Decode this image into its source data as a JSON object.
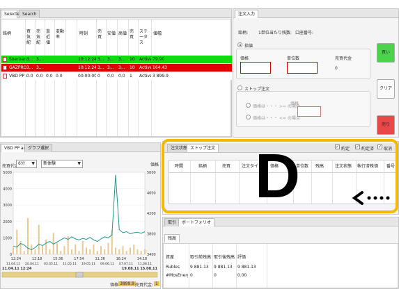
{
  "top_tabs": [
    "Selected tab",
    "Search"
  ],
  "instruments_grid": {
    "headers": [
      "銘柄",
      "買気配",
      "売気配",
      "直近値",
      "変動率",
      "時刻",
      "売買",
      "安値",
      "高値",
      "売買",
      "ステータス",
      "値幅"
    ],
    "rows": [
      {
        "icon": "red-doc-icon",
        "name": "Sberbank",
        "buy": "3...",
        "sell": "3...",
        "last": "",
        "chg": "",
        "time": "10:12:24",
        "v1": "3...",
        "low": "3...",
        "high": "3...",
        "v2": "10",
        "status": "Active",
        "range": "79.90",
        "color": "#0fdc0f"
      },
      {
        "icon": "red-doc-icon",
        "name": "GAZPROM ao",
        "buy": "3...",
        "sell": "3...",
        "last": "",
        "chg": "",
        "time": "10:12:24",
        "v1": "3...",
        "low": "3...",
        "high": "3...",
        "v2": "10",
        "status": "Active",
        "range": "164.43",
        "color": "#e00000"
      },
      {
        "icon": "red-doc-icon",
        "name": "VBD PP ao",
        "buy": "0.0",
        "sell": "0.0",
        "last": "0.0",
        "chg": "0.0",
        "time": "00:00:00",
        "v1": "0",
        "low": "0.0",
        "high": "0.0",
        "v2": "1",
        "status": "Active",
        "range": "3 899.9",
        "color": "#ffffff"
      }
    ]
  },
  "order_entry": {
    "tab": "注文入力",
    "label_symbol": "銘柄:",
    "symbol_value": "1単位当たり残数:",
    "label_account": "口座番号:",
    "limit_label": "指値",
    "price_label": "価格",
    "qty_label": "単位数",
    "total_label": "売買代金",
    "total_value": "0",
    "stop_label": "ストップ注文",
    "cond_above": "価格は・・・ >= の場合",
    "cond_below": "価格は・・・ <= の場合",
    "trigger_label": "価格",
    "buy_label": "買い",
    "clear_label": "クリア",
    "sell_label": "売り",
    "buy_color": "#4cd34c",
    "sell_color": "#e84848"
  },
  "chart_panel": {
    "tabs": [
      "VBD PP ao",
      "グラフ選択"
    ],
    "interval_label": "売買代金",
    "interval_value": "6分",
    "style_value": "新体験",
    "right_label": "価格",
    "footer_price_label": "価格:",
    "footer_price": "3899.9",
    "footer_vol_label": "売買代金:",
    "footer_vol": "1"
  },
  "chart_data": {
    "type": "line",
    "x": [
      "12:24",
      "12:18",
      "15:36",
      "17:54",
      "11:36",
      "16:24",
      "14:18"
    ],
    "dates": [
      "11.04.11",
      "20.04.11",
      "03.05.11",
      "11.05.11",
      "19.05.11",
      "09.06.11",
      "07.07.11",
      "11.08.11"
    ],
    "range_start": "11.04.11 12:24",
    "range_end": "19.08.11 15.08.11",
    "left_axis": [
      5000,
      4000,
      3000,
      2000,
      1000,
      0
    ],
    "right_axis": [
      5000,
      4600,
      4200,
      3800,
      3400
    ],
    "ylim_price": [
      3400,
      5000
    ],
    "ylim_volume": [
      0,
      5000
    ],
    "price_series": [
      3560,
      3540,
      3610,
      3580,
      3520,
      3490,
      3530,
      3600,
      3570,
      3620,
      3650,
      3600,
      3640,
      3680,
      3720,
      3690,
      3740,
      3700,
      3680,
      3710,
      3690,
      3730,
      3680,
      3650,
      3700,
      3740,
      3720,
      3780,
      4950,
      3880,
      3820,
      3840,
      3800,
      3820,
      3830,
      3810,
      3840
    ],
    "volume_series": [
      400,
      1500,
      800,
      200,
      2200,
      600,
      300,
      1800,
      500,
      900,
      300,
      1300,
      700,
      200,
      500,
      1100,
      300,
      600,
      200,
      800,
      400,
      300,
      600,
      200,
      500,
      300,
      700,
      1500,
      400,
      300,
      500,
      200,
      400,
      600,
      300,
      200,
      300
    ]
  },
  "orders_panel": {
    "tabs": [
      "注文状態",
      "ストップ注文"
    ],
    "checkboxes": [
      "約定",
      "約定済",
      "取消"
    ],
    "headers": [
      "時間",
      "銘柄",
      "売買",
      "注文タイプ",
      "価格",
      "単位数",
      "残高",
      "注文状態",
      "執行済株価",
      "番号"
    ],
    "annotation_letter": "D",
    "highlight_color": "#f5b800"
  },
  "portfolio_panel": {
    "tabs": [
      "取引",
      "ポートフォリオ"
    ],
    "subtab": "残高",
    "headers": [
      "資産",
      "取引前残高",
      "取引後残高",
      "評価"
    ],
    "rows": [
      [
        "Rubles",
        "9 881.13",
        "9 881.13",
        "9 881.13"
      ],
      [
        "#MosEnerg...",
        "0",
        "0",
        "0.00"
      ]
    ]
  }
}
